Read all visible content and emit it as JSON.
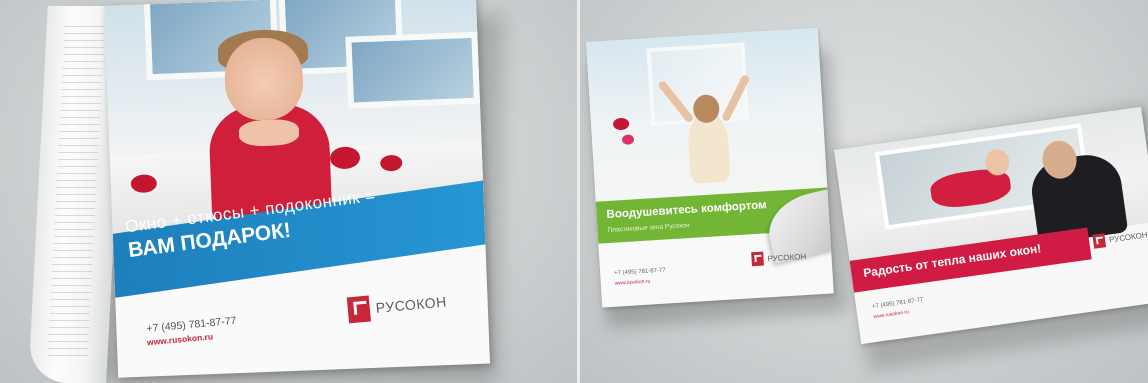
{
  "magazine": {
    "headline_line1": "Окно + откосы + подоконник =",
    "headline_line2": "ВАМ ПОДАРОК!",
    "brand": "РУСОКОН",
    "phone": "+7 (495) 781-87-77",
    "site": "www.rusokon.ru"
  },
  "brochure": {
    "title": "Воодушевитесь комфортом",
    "subtitle": "Пластиковые окна Русокон",
    "brand": "РУСОКОН",
    "phone": "+7 (495) 781-87-77",
    "site": "www.rusokon.ru"
  },
  "flyer": {
    "title": "Радость от тепла наших окон!",
    "brand": "РУСОКОН",
    "phone": "+7 (495) 781-87-77",
    "site": "www.rusokon.ru"
  },
  "colors": {
    "brand_red": "#c4283a",
    "magazine_band_blue": "#2696d3",
    "brochure_band_green": "#73b636",
    "flyer_band_red": "#d01c44",
    "background_gray": "#cfd2d3"
  }
}
